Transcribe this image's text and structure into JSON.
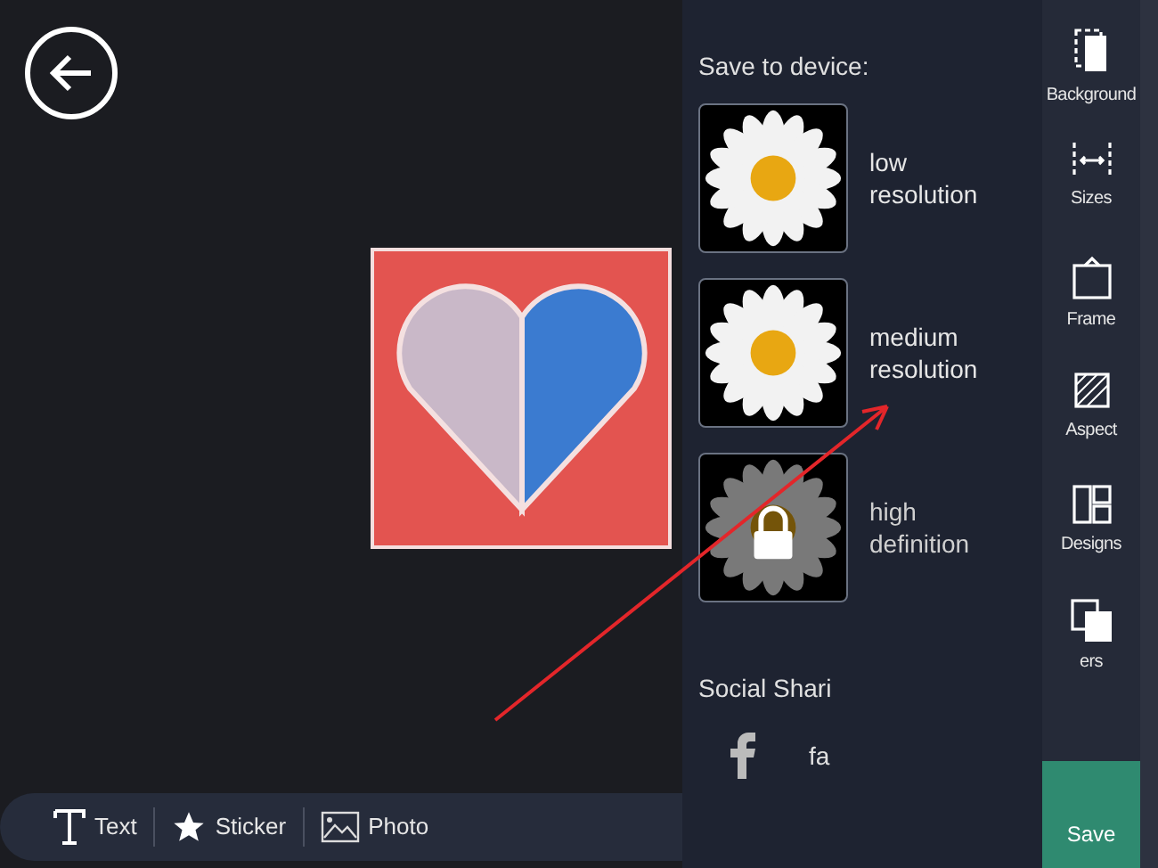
{
  "save_panel": {
    "title": "Save to device:",
    "options": [
      {
        "label": "low resolution",
        "locked": false
      },
      {
        "label": "medium resolution",
        "locked": false
      },
      {
        "label": "high definition",
        "locked": true
      }
    ],
    "social_title": "Social Shari",
    "social_items": [
      {
        "label": "fa"
      }
    ]
  },
  "side_toolbar": [
    {
      "kind": "background",
      "label": "Background"
    },
    {
      "kind": "sizes",
      "label": "Sizes"
    },
    {
      "kind": "frame",
      "label": "Frame"
    },
    {
      "kind": "aspect",
      "label": "Aspect"
    },
    {
      "kind": "designs",
      "label": "Designs"
    },
    {
      "kind": "layers",
      "label": "ers"
    }
  ],
  "save_button": {
    "label": "Save"
  },
  "bottom_toolbar": [
    {
      "kind": "text",
      "label": "Text"
    },
    {
      "kind": "sticker",
      "label": "Sticker"
    },
    {
      "kind": "photo",
      "label": "Photo"
    }
  ]
}
